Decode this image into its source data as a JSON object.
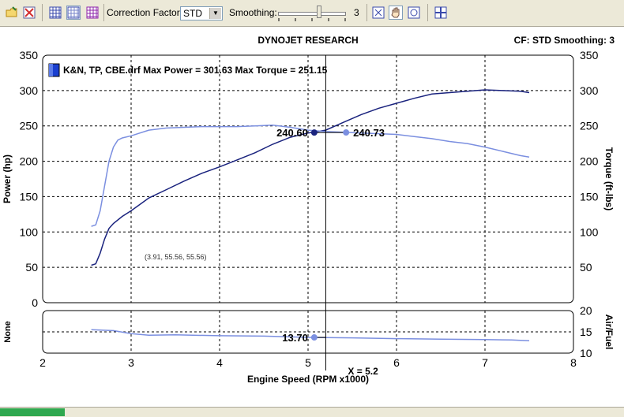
{
  "toolbar": {
    "correction_label": "Correction Factor:",
    "correction_value": "STD",
    "smoothing_label": "Smoothing:",
    "smoothing_value": "3",
    "slider_fraction": 0.6,
    "icons": [
      "open-folder-icon",
      "delete-icon",
      "grid-icon",
      "grid-alt-icon",
      "grid-color-icon",
      "zoom-fit-icon",
      "hand-pan-icon",
      "zoom-icon",
      "layout-icon"
    ]
  },
  "chart_data": {
    "type": "line",
    "title": "DYNOJET RESEARCH",
    "header_right": "CF: STD  Smoothing: 3",
    "legend": "K&N, TP, CBE.drf Max Power = 301.63 Max Torque = 251.15",
    "main": {
      "xlim": [
        2,
        8
      ],
      "ylim": [
        0,
        350
      ],
      "y_ticks": [
        0,
        50,
        100,
        150,
        200,
        250,
        300,
        350
      ],
      "y_right_ticks": [
        50,
        100,
        150,
        200,
        250,
        300,
        350
      ],
      "ylabel": "Power (hp)",
      "ylabel_right": "Torque (ft-lbs)",
      "series": [
        {
          "name": "Power",
          "color": "#1a237e",
          "x": [
            2.55,
            2.6,
            2.65,
            2.7,
            2.75,
            2.8,
            2.9,
            3.0,
            3.2,
            3.4,
            3.6,
            3.8,
            4.0,
            4.2,
            4.4,
            4.6,
            4.8,
            5.0,
            5.2,
            5.4,
            5.6,
            5.8,
            6.0,
            6.2,
            6.4,
            6.6,
            6.8,
            7.0,
            7.2,
            7.4,
            7.5
          ],
          "y": [
            53,
            55,
            70,
            90,
            105,
            112,
            122,
            130,
            148,
            160,
            172,
            183,
            192,
            202,
            212,
            224,
            234,
            240,
            244,
            255,
            266,
            275,
            282,
            289,
            295,
            297,
            299,
            301,
            300,
            299,
            297
          ]
        },
        {
          "name": "Torque",
          "color": "#7b8fe0",
          "x": [
            2.55,
            2.6,
            2.65,
            2.7,
            2.75,
            2.8,
            2.85,
            2.9,
            3.0,
            3.2,
            3.4,
            3.6,
            3.8,
            4.0,
            4.2,
            4.4,
            4.6,
            4.8,
            5.0,
            5.2,
            5.4,
            5.6,
            5.8,
            6.0,
            6.2,
            6.4,
            6.6,
            6.8,
            7.0,
            7.2,
            7.4,
            7.5
          ],
          "y": [
            108,
            110,
            130,
            165,
            200,
            220,
            230,
            233,
            236,
            244,
            247,
            248,
            249,
            249,
            249,
            250,
            251,
            248,
            244,
            242,
            241,
            240,
            239,
            238,
            235,
            232,
            228,
            225,
            220,
            214,
            208,
            206
          ]
        }
      ],
      "cursor_x": 5.2,
      "readouts": [
        {
          "label": "240.60",
          "x": 5.07,
          "y": 240.6,
          "series": "Power"
        },
        {
          "label": "240.73",
          "x": 5.43,
          "y": 240.73,
          "series": "Torque"
        }
      ],
      "annotation": "(3.91, 55.56, 55.56)"
    },
    "afr": {
      "xlim": [
        2,
        8
      ],
      "ylim": [
        10,
        20
      ],
      "y_ticks": [
        10,
        15,
        20
      ],
      "ylabel": "None",
      "ylabel_right": "Air/Fuel",
      "series": [
        {
          "name": "Air/Fuel",
          "color": "#7b8fe0",
          "x": [
            2.55,
            2.8,
            3.0,
            3.2,
            3.5,
            4.0,
            4.5,
            5.0,
            5.5,
            6.0,
            6.5,
            7.0,
            7.3,
            7.5
          ],
          "y": [
            15.5,
            15.3,
            14.6,
            14.2,
            14.3,
            14.1,
            14.0,
            13.7,
            13.6,
            13.4,
            13.3,
            13.2,
            13.1,
            12.9
          ]
        }
      ],
      "readout": {
        "label": "13.70",
        "x": 5.07,
        "y": 13.7
      }
    },
    "x_ticks": [
      2,
      3,
      4,
      5,
      6,
      7,
      8
    ],
    "xlabel": "Engine Speed (RPM x1000)",
    "cursor_label": "X = 5.2"
  }
}
